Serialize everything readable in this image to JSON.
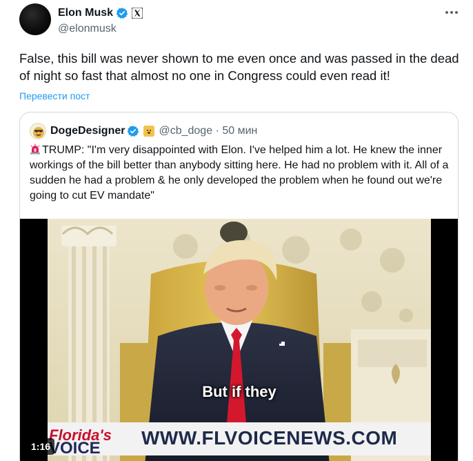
{
  "author": {
    "display_name": "Elon Musk",
    "handle": "@elonmusk"
  },
  "tweet": {
    "text": "False, this bill was never shown to me even once and was passed in the dead of night so fast that almost no one in Congress could even read it!",
    "translate_label": "Перевести пост"
  },
  "quoted": {
    "display_name": "DogeDesigner",
    "handle_time": "@cb_doge · 50 мин",
    "text": "TRUMP: \"I'm very disappointed with Elon. I've helped him a lot. He knew the inner workings of the bill better than anybody sitting here. He had no problem with it. All of a sudden he had a problem & he only developed the problem when he found out we're going to cut EV mandate\"",
    "video": {
      "caption": "But if they",
      "banner_logo_line1": "Florida's",
      "banner_logo_line2": "VOICE",
      "banner_url": "WWW.FLVOICENEWS.COM",
      "duration": "1:16"
    }
  },
  "colors": {
    "accent": "#1d9bf0",
    "secondary_text": "#536471",
    "border": "#cfd9de"
  },
  "icons": [
    "verified-badge-icon",
    "x-logo-icon",
    "more-options-icon",
    "siren-icon"
  ]
}
